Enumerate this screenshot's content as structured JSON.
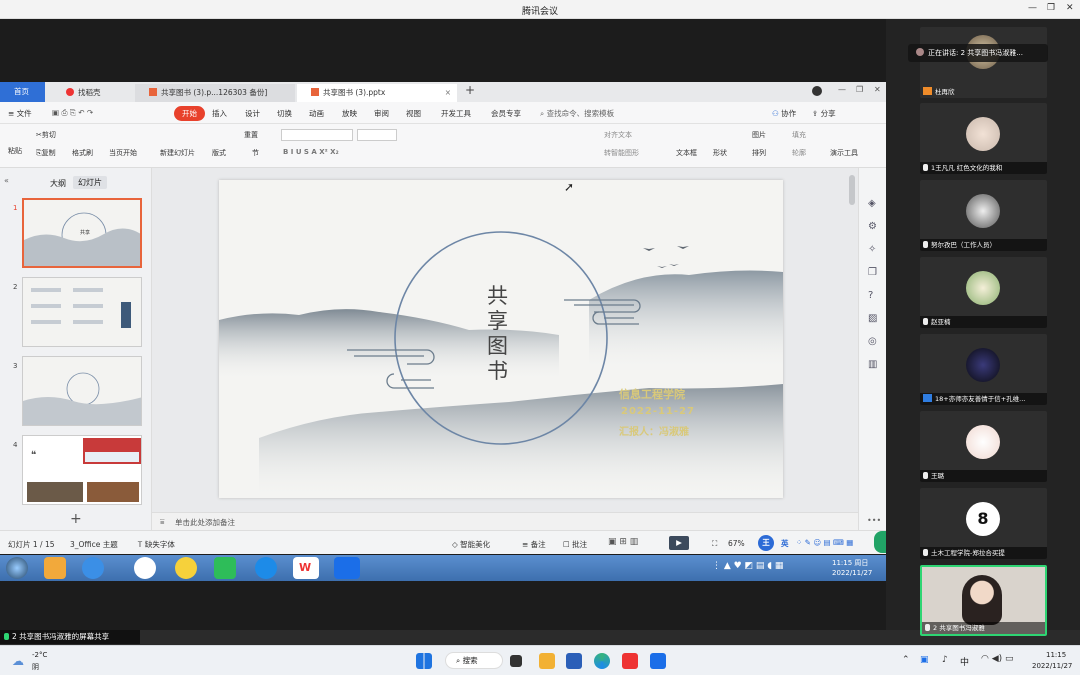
{
  "app": {
    "title": "腾讯会议"
  },
  "wps": {
    "tabs": [
      {
        "label": "首页"
      },
      {
        "label": "找稻壳"
      },
      {
        "label": "共享图书 (3).p...126303 备份]"
      },
      {
        "label": "共享图书 (3).pptx"
      }
    ],
    "menu": [
      "文件",
      "开始",
      "插入",
      "设计",
      "切换",
      "动画",
      "放映",
      "审阅",
      "视图",
      "开发工具",
      "会员专享"
    ],
    "search_placeholder": "查找命令、搜索模板",
    "collab": "协作",
    "share_btn": "分享",
    "ribbon": {
      "cut": "剪切",
      "paste": "粘贴",
      "copy": "复制",
      "format_painter": "格式刷",
      "play_from": "当页开始",
      "new_slide": "新建幻灯片",
      "layout": "版式",
      "section": "节",
      "reset": "重置",
      "textbox": "文本框",
      "shape": "形状",
      "arrange": "排列",
      "picture": "图片",
      "fill": "填充",
      "outline": "轮廓",
      "present": "演示工具",
      "align_text": "对齐文本",
      "smart": "转智能图形"
    },
    "panel_tabs": [
      "大纲",
      "幻灯片"
    ],
    "thumb_numbers": [
      "1",
      "2",
      "3",
      "4"
    ],
    "notes_placeholder": "单击此处添加备注",
    "slide": {
      "title_chars": [
        "共",
        "享",
        "图",
        "书"
      ],
      "school": "信息工程学院",
      "date": "2022-11-27",
      "reporter": "汇报人：冯淑雅"
    },
    "status": {
      "slide_count": "幻灯片 1 / 15",
      "theme": "3_Office 主题",
      "missing_font": "缺失字体",
      "smart": "智能美化",
      "notes": "备注",
      "comments": "批注",
      "zoom": "67%",
      "ime": "英"
    }
  },
  "meeting": {
    "speaking": "正在讲话: 2 共享图书冯淑雅...",
    "participants": [
      {
        "name": "杜再欣"
      },
      {
        "name": "1王凡凡 红色文化的我和"
      },
      {
        "name": "努尔孜巴（工作人员）"
      },
      {
        "name": "赵亚楠"
      },
      {
        "name": "18+亦师亦友善情于信+孔维..."
      },
      {
        "name": "王璐"
      },
      {
        "name": "土木工程学院-郑拉合买提"
      },
      {
        "name": "2 共享图书冯淑雅"
      }
    ],
    "share_label": "2 共享图书冯淑雅的屏幕共享"
  },
  "old_taskbar": {
    "time": "11:15 周日",
    "date": "2022/11/27"
  },
  "win11": {
    "weather_temp": "-2°C",
    "weather_desc": "阴",
    "search": "搜索",
    "ime": "中",
    "time": "11:15",
    "date": "2022/11/27"
  }
}
